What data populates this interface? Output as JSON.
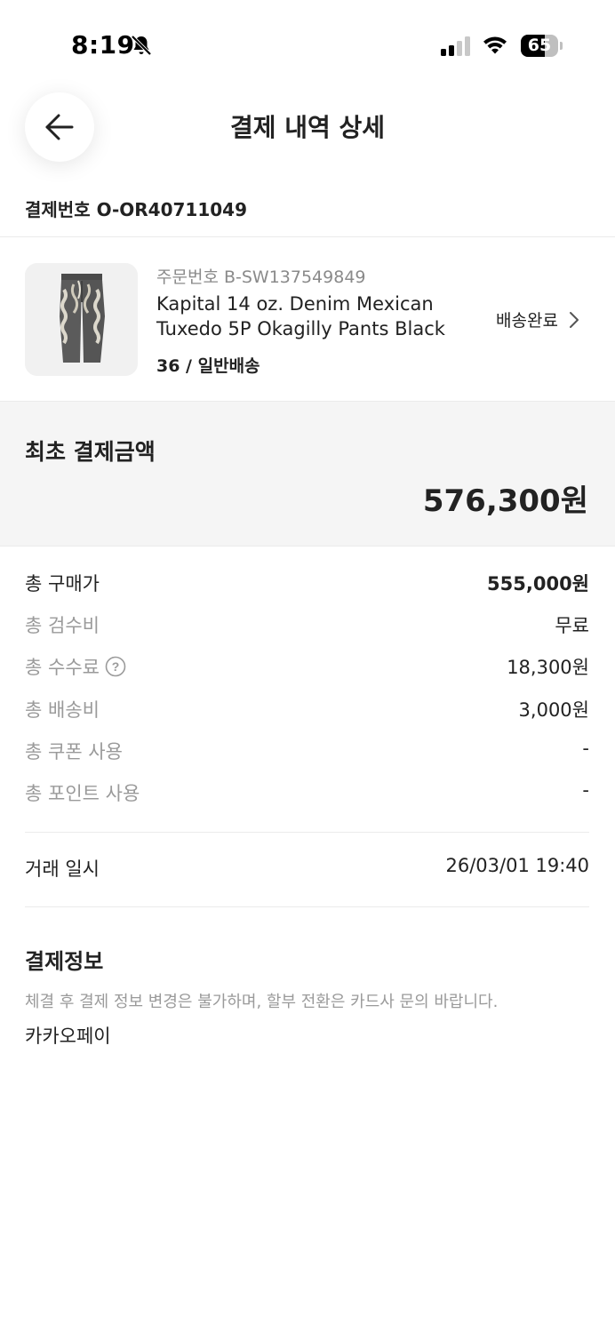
{
  "status_bar": {
    "time": "8:19",
    "battery_level": "65",
    "battery_fraction": 0.65
  },
  "header": {
    "title": "결제 내역 상세",
    "back_icon": "arrow-left-icon"
  },
  "payment": {
    "number_label": "결제번호",
    "number_value": "O-OR40711049"
  },
  "order": {
    "order_number_label": "주문번호",
    "order_number_value": "B-SW137549849",
    "product_name": "Kapital 14 oz. Denim Mexican Tuxedo 5P Okagilly Pants Black",
    "option": "36 / 일반배송",
    "delivery_status": "배송완료",
    "thumbnail_icon": "pants-image"
  },
  "total": {
    "label": "최초 결제금액",
    "amount": "576,300원"
  },
  "breakdown": [
    {
      "label": "총 구매가",
      "value": "555,000원"
    },
    {
      "label": "총 검수비",
      "value": "무료"
    },
    {
      "label": "총 수수료",
      "value": "18,300원"
    },
    {
      "label": "총 배송비",
      "value": "3,000원"
    },
    {
      "label": "총 쿠폰 사용",
      "value": "-"
    },
    {
      "label": "총 포인트 사용",
      "value": "-"
    }
  ],
  "transaction": {
    "label": "거래 일시",
    "value": "26/03/01 19:40"
  },
  "payment_info": {
    "title": "결제정보",
    "notice": "체결 후 결제 정보 변경은 불가하며, 할부 전환은 카드사 문의 바랍니다.",
    "method": "카카오페이"
  },
  "colors": {
    "text_primary": "#222222",
    "text_secondary": "#9a9a9a",
    "section_bg": "#f5f5f5",
    "divider": "#ebebeb"
  }
}
